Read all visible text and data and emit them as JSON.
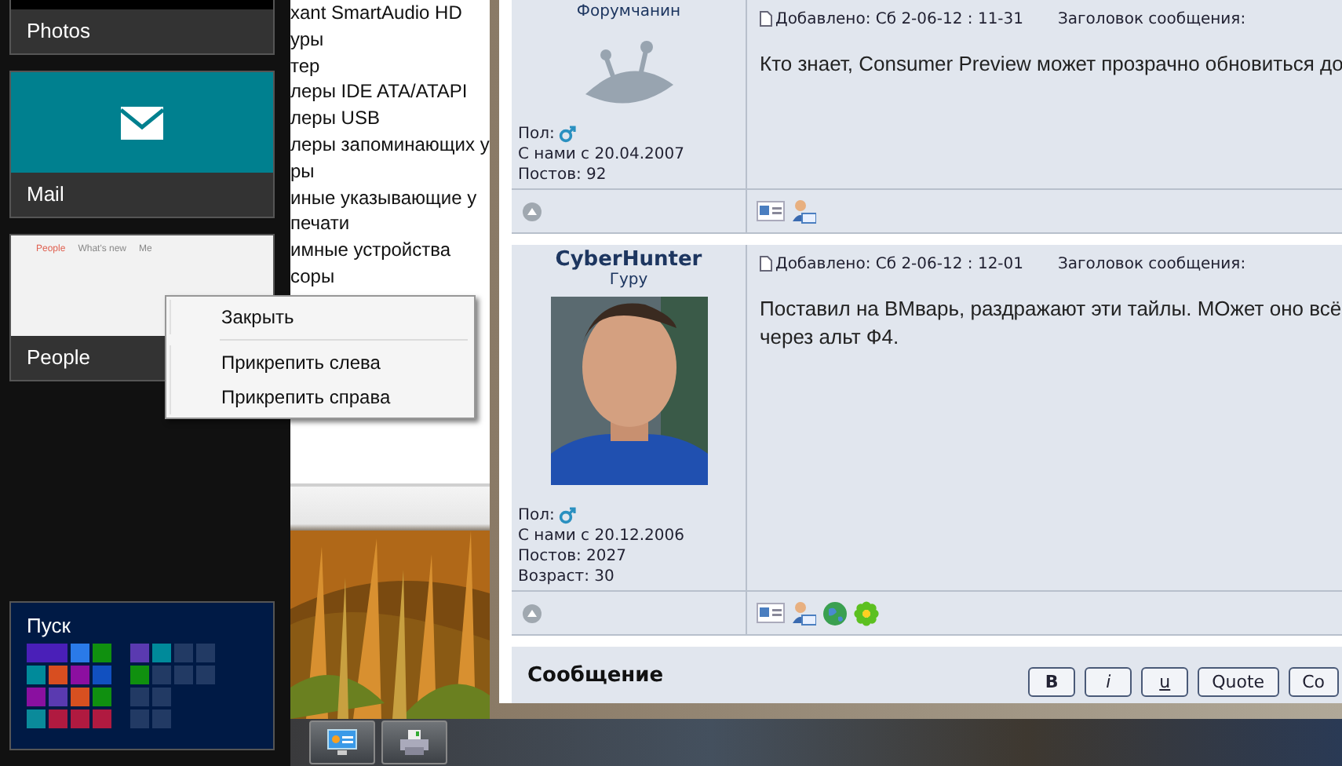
{
  "switcher": {
    "apps": [
      {
        "label": "Photos",
        "kind": "plain"
      },
      {
        "label": "Mail",
        "kind": "mail"
      },
      {
        "label": "People",
        "kind": "people",
        "tabs": [
          {
            "label": "People",
            "selected": true
          },
          {
            "label": "What's new",
            "selected": false
          },
          {
            "label": "Me",
            "selected": false
          }
        ]
      }
    ],
    "start": {
      "label": "Пуск"
    }
  },
  "device_list": [
    "xant SmartAudio HD",
    "уры",
    "тер",
    "леры IDE ATA/ATAPI",
    "леры USB",
    "леры запоминающих у",
    "ры",
    "иные указывающие у",
    "печати",
    "имные устройства",
    "соры"
  ],
  "context_menu": {
    "groups": [
      [
        "Закрыть"
      ],
      [
        "Прикрепить слева",
        "Прикрепить справа"
      ]
    ]
  },
  "forum": {
    "posts": [
      {
        "rank": "Форумчанин",
        "avatar": {
          "kind": "default"
        },
        "gender_label": "Пол:",
        "info": [
          "С нами с 20.04.2007",
          "Постов: 92"
        ],
        "added": "Добавлено: Сб 2-06-12 : 11-31",
        "subject": "Заголовок сообщения:",
        "body": [
          "Кто знает, Consumer Preview может прозрачно обновиться до"
        ],
        "actions": [
          {
            "kind": "profile"
          },
          {
            "kind": "pm"
          }
        ]
      },
      {
        "author": "CyberHunter",
        "rank": "Гуру",
        "avatar": {
          "kind": "picture"
        },
        "gender_label": "Пол:",
        "info": [
          "С нами с 20.12.2006",
          "Постов: 2027",
          "Возраст: 30"
        ],
        "added": "Добавлено: Сб 2-06-12 : 12-01",
        "subject": "Заголовок сообщения:",
        "body": [
          "Поставил на ВМварь, раздражают эти тайлы. МОжет оно всё",
          "через альт Ф4."
        ],
        "actions": [
          {
            "kind": "profile"
          },
          {
            "kind": "pm"
          },
          {
            "kind": "www"
          },
          {
            "kind": "icq"
          }
        ]
      }
    ],
    "editor": {
      "label": "Сообщение",
      "buttons": [
        {
          "label": "B",
          "kind": "bold"
        },
        {
          "label": "i",
          "kind": "italic"
        },
        {
          "label": "u",
          "kind": "underline"
        },
        {
          "label": "Quote",
          "kind": "plain"
        },
        {
          "label": "Co",
          "kind": "plain"
        }
      ]
    }
  },
  "taskbar": {
    "buttons": [
      {
        "kind": "contact"
      },
      {
        "kind": "printer"
      }
    ]
  }
}
